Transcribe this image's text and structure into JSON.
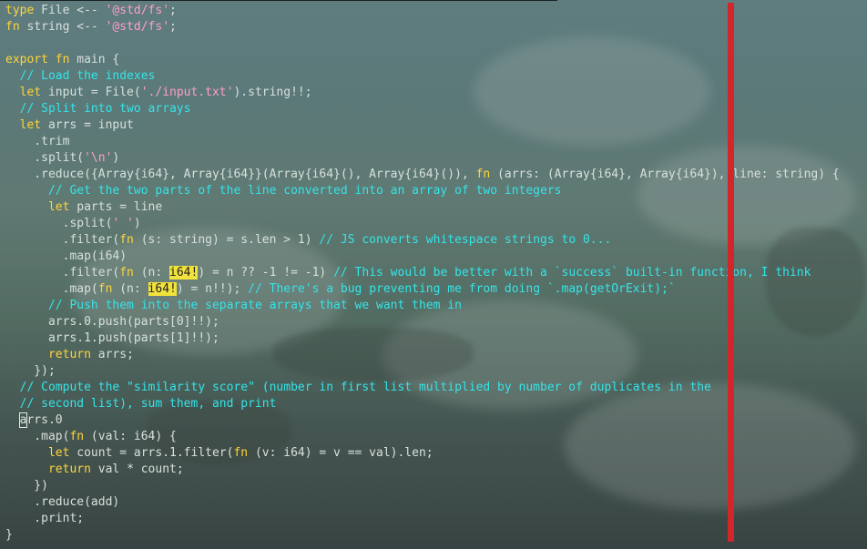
{
  "editor": {
    "lines": [
      [
        {
          "t": "type",
          "c": "kw"
        },
        {
          "t": " File <-- "
        },
        {
          "t": "'@std/fs'",
          "c": "str"
        },
        {
          "t": ";"
        }
      ],
      [
        {
          "t": "fn",
          "c": "kw"
        },
        {
          "t": " string <-- "
        },
        {
          "t": "'@std/fs'",
          "c": "str"
        },
        {
          "t": ";"
        }
      ],
      [],
      [
        {
          "t": "export",
          "c": "kw"
        },
        {
          "t": " "
        },
        {
          "t": "fn",
          "c": "kw"
        },
        {
          "t": " main {"
        }
      ],
      [
        {
          "t": "  "
        },
        {
          "t": "// Load the indexes",
          "c": "cm"
        }
      ],
      [
        {
          "t": "  "
        },
        {
          "t": "let",
          "c": "kw"
        },
        {
          "t": " input = File("
        },
        {
          "t": "'./input.txt'",
          "c": "str"
        },
        {
          "t": ").string!!;"
        }
      ],
      [
        {
          "t": "  "
        },
        {
          "t": "// Split into two arrays",
          "c": "cm"
        }
      ],
      [
        {
          "t": "  "
        },
        {
          "t": "let",
          "c": "kw"
        },
        {
          "t": " arrs = input"
        }
      ],
      [
        {
          "t": "    .trim"
        }
      ],
      [
        {
          "t": "    .split("
        },
        {
          "t": "'\\n'",
          "c": "str"
        },
        {
          "t": ")"
        }
      ],
      [
        {
          "t": "    .reduce({Array{i64}, Array{i64}}(Array{i64}(), Array{i64}()), "
        },
        {
          "t": "fn",
          "c": "kw"
        },
        {
          "t": " (arrs: (Array{i64}, Array{i64}), line: string) {"
        }
      ],
      [
        {
          "t": "      "
        },
        {
          "t": "// Get the two parts of the line converted into an array of two integers",
          "c": "cm"
        }
      ],
      [
        {
          "t": "      "
        },
        {
          "t": "let",
          "c": "kw"
        },
        {
          "t": " parts = line"
        }
      ],
      [
        {
          "t": "        .split("
        },
        {
          "t": "' '",
          "c": "str"
        },
        {
          "t": ")"
        }
      ],
      [
        {
          "t": "        .filter("
        },
        {
          "t": "fn",
          "c": "kw"
        },
        {
          "t": " (s: string) = s.len > 1) "
        },
        {
          "t": "// JS converts whitespace strings to 0...",
          "c": "cm"
        }
      ],
      [
        {
          "t": "        .map(i64)"
        }
      ],
      [
        {
          "t": "        .filter("
        },
        {
          "t": "fn",
          "c": "kw"
        },
        {
          "t": " (n: "
        },
        {
          "t": "i64!",
          "c": "hl"
        },
        {
          "t": ") = n ?? -1 != -1) "
        },
        {
          "t": "// This would be better with a `success` built-in function, I think",
          "c": "cm"
        }
      ],
      [
        {
          "t": "        .map("
        },
        {
          "t": "fn",
          "c": "kw"
        },
        {
          "t": " (n: "
        },
        {
          "t": "i64!",
          "c": "hl"
        },
        {
          "t": ") = n!!); "
        },
        {
          "t": "// There's a bug preventing me from doing `.map(getOrExit);`",
          "c": "cm"
        }
      ],
      [
        {
          "t": "      "
        },
        {
          "t": "// Push them into the separate arrays that we want them in",
          "c": "cm"
        }
      ],
      [
        {
          "t": "      arrs.0.push(parts[0]!!);"
        }
      ],
      [
        {
          "t": "      arrs.1.push(parts[1]!!);"
        }
      ],
      [
        {
          "t": "      "
        },
        {
          "t": "return",
          "c": "kw"
        },
        {
          "t": " arrs;"
        }
      ],
      [
        {
          "t": "    });"
        }
      ],
      [
        {
          "t": "  "
        },
        {
          "t": "// Compute the \"similarity score\" (number in first list multiplied by number of duplicates in the",
          "c": "cm"
        }
      ],
      [
        {
          "t": "  "
        },
        {
          "t": "// second list), sum them, and print",
          "c": "cm"
        }
      ],
      [
        {
          "t": "  "
        },
        {
          "t": "a",
          "c": "cursor"
        },
        {
          "t": "rrs.0"
        }
      ],
      [
        {
          "t": "    .map("
        },
        {
          "t": "fn",
          "c": "kw"
        },
        {
          "t": " (val: i64) {"
        }
      ],
      [
        {
          "t": "      "
        },
        {
          "t": "let",
          "c": "kw"
        },
        {
          "t": " count = arrs.1.filter("
        },
        {
          "t": "fn",
          "c": "kw"
        },
        {
          "t": " (v: i64) = v == val).len;"
        }
      ],
      [
        {
          "t": "      "
        },
        {
          "t": "return",
          "c": "kw"
        },
        {
          "t": " val * count;"
        }
      ],
      [
        {
          "t": "    })"
        }
      ],
      [
        {
          "t": "    .reduce(add)"
        }
      ],
      [
        {
          "t": "    .print;"
        }
      ],
      [
        {
          "t": "}"
        }
      ]
    ]
  },
  "colors": {
    "keyword": "#ffd53a",
    "string": "#ff9ec8",
    "comment": "#34e4e8",
    "highlight": "#f2e23c",
    "ruler": "#d3262a"
  }
}
